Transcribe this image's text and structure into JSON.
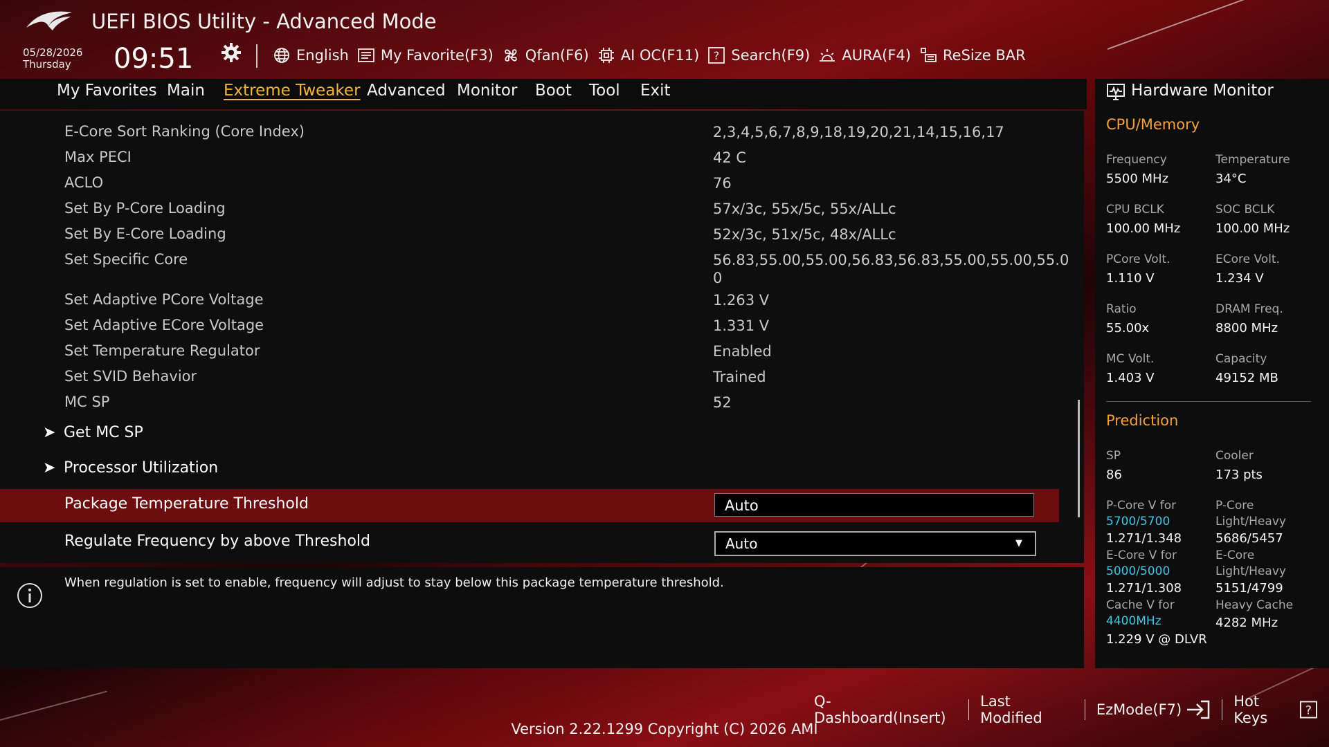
{
  "header": {
    "app_title": "UEFI BIOS Utility - Advanced Mode",
    "date": "05/28/2026",
    "weekday": "Thursday",
    "time": "09:51",
    "nav": [
      {
        "label": "English",
        "icon": "globe-icon"
      },
      {
        "label": "My Favorite(F3)",
        "icon": "favorite-list-icon"
      },
      {
        "label": "Qfan(F6)",
        "icon": "fan-icon"
      },
      {
        "label": "AI OC(F11)",
        "icon": "ai-chip-icon"
      },
      {
        "label": "Search(F9)",
        "icon": "search-help-icon"
      },
      {
        "label": "AURA(F4)",
        "icon": "aura-light-icon"
      },
      {
        "label": "ReSize BAR",
        "icon": "resize-bar-icon"
      }
    ]
  },
  "tabs": [
    {
      "label": "My Favorites"
    },
    {
      "label": "Main"
    },
    {
      "label": "Extreme Tweaker",
      "active": true
    },
    {
      "label": "Advanced"
    },
    {
      "label": "Monitor"
    },
    {
      "label": "Boot"
    },
    {
      "label": "Tool"
    },
    {
      "label": "Exit"
    }
  ],
  "settings": [
    {
      "label": "E-Core Sort Ranking (Core Index)",
      "value": "2,3,4,5,6,7,8,9,18,19,20,21,14,15,16,17"
    },
    {
      "label": "Max PECI",
      "value": "42 C"
    },
    {
      "label": "ACLO",
      "value": "76"
    },
    {
      "label": "Set By P-Core Loading",
      "value": "57x/3c, 55x/5c, 55x/ALLc"
    },
    {
      "label": "Set By E-Core Loading",
      "value": "52x/3c, 51x/5c, 48x/ALLc"
    },
    {
      "label": "Set Specific Core",
      "value": "56.83,55.00,55.00,56.83,56.83,55.00,55.00,55.0 0"
    },
    {
      "label": "Set Adaptive PCore Voltage",
      "value": "1.263 V"
    },
    {
      "label": "Set Adaptive ECore Voltage",
      "value": "1.331 V"
    },
    {
      "label": "Set Temperature Regulator",
      "value": "Enabled"
    },
    {
      "label": "Set SVID Behavior",
      "value": "Trained"
    },
    {
      "label": "MC SP",
      "value": "52"
    }
  ],
  "submenus": [
    {
      "label": "Get MC SP"
    },
    {
      "label": "Processor Utilization"
    }
  ],
  "selected_setting": {
    "label": "Package Temperature Threshold",
    "value": "Auto"
  },
  "dropdown_setting": {
    "label": "Regulate Frequency by above Threshold",
    "value": "Auto"
  },
  "help_text": "When regulation is set to enable, frequency will adjust to stay below this package temperature threshold.",
  "hardware_monitor": {
    "title": "Hardware Monitor",
    "cpu_memory": {
      "heading": "CPU/Memory",
      "items": [
        {
          "label": "Frequency",
          "value": "5500 MHz"
        },
        {
          "label": "Temperature",
          "value": "34°C"
        },
        {
          "label": "CPU BCLK",
          "value": "100.00 MHz"
        },
        {
          "label": "SOC BCLK",
          "value": "100.00 MHz"
        },
        {
          "label": "PCore Volt.",
          "value": "1.110 V"
        },
        {
          "label": "ECore Volt.",
          "value": "1.234 V"
        },
        {
          "label": "Ratio",
          "value": "55.00x"
        },
        {
          "label": "DRAM Freq.",
          "value": "8800 MHz"
        },
        {
          "label": "MC Volt.",
          "value": "1.403 V"
        },
        {
          "label": "Capacity",
          "value": "49152 MB"
        }
      ]
    },
    "prediction": {
      "heading": "Prediction",
      "sp_label": "SP",
      "sp_value": "86",
      "cooler_label": "Cooler",
      "cooler_value": "173 pts",
      "pcore_v_label": "P-Core V for",
      "pcore_v_freq": "5700/5700",
      "pcore_v_value": "1.271/1.348",
      "pcore_lh_label_1": "P-Core",
      "pcore_lh_label_2": "Light/Heavy",
      "pcore_lh_value": "5686/5457",
      "ecore_v_label": "E-Core V for",
      "ecore_v_freq": "5000/5000",
      "ecore_v_value": "1.271/1.308",
      "ecore_lh_label_1": "E-Core",
      "ecore_lh_label_2": "Light/Heavy",
      "ecore_lh_value": "5151/4799",
      "cache_v_label": "Cache V for",
      "cache_v_freq": "4400MHz",
      "cache_v_value": "1.229 V @ DLVR",
      "heavy_cache_label": "Heavy Cache",
      "heavy_cache_value": "4282 MHz"
    }
  },
  "footer": {
    "nav": [
      {
        "label": "Q-Dashboard(Insert)"
      },
      {
        "label": "Last Modified"
      },
      {
        "label": "EzMode(F7)"
      },
      {
        "label": "Hot Keys"
      }
    ],
    "version": "Version 2.22.1299 Copyright (C) 2026 AMI"
  },
  "colors": {
    "accent": "#f3b43b",
    "selection": "#6e0d10",
    "highlight_value": "#3fc6e6",
    "brand_red": "#8a0f15"
  }
}
